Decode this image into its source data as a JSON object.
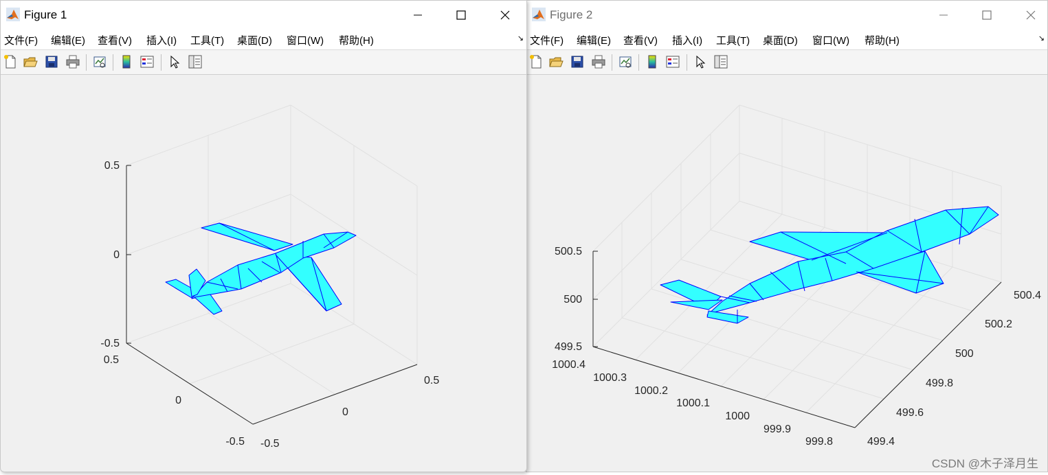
{
  "colors": {
    "surface": "#33ffff",
    "edge": "#0000ff",
    "axis": "#262626",
    "grid": "#e0e0e0"
  },
  "icons": [
    "new-figure-icon",
    "open-file-icon",
    "save-icon",
    "print-icon",
    "link-plot-icon",
    "colorbar-icon",
    "legend-icon",
    "edit-plot-arrow-icon",
    "property-inspector-icon"
  ],
  "menu": [
    {
      "id": "file",
      "label": "文件(F)"
    },
    {
      "id": "edit",
      "label": "编辑(E)"
    },
    {
      "id": "view",
      "label": "查看(V)"
    },
    {
      "id": "insert",
      "label": "插入(I)"
    },
    {
      "id": "tools",
      "label": "工具(T)"
    },
    {
      "id": "desktop",
      "label": "桌面(D)"
    },
    {
      "id": "window",
      "label": "窗口(W)"
    },
    {
      "id": "help",
      "label": "帮助(H)"
    }
  ],
  "windows": [
    {
      "title": "Figure 1",
      "ticks": {
        "z": [
          "0.5",
          "0",
          "-0.5"
        ],
        "x": [
          "0.5",
          "0",
          "-0.5"
        ],
        "y": [
          "-0.5",
          "0",
          "0.5"
        ]
      }
    },
    {
      "title": "Figure 2",
      "ticks": {
        "z": [
          "500.5",
          "500",
          "499.5"
        ],
        "x": [
          "1000.4",
          "1000.3",
          "1000.2",
          "1000.1",
          "1000",
          "999.9",
          "999.8"
        ],
        "y": [
          "499.4",
          "499.6",
          "499.8",
          "500",
          "500.2",
          "500.4"
        ]
      }
    }
  ],
  "watermark": "CSDN @木子泽月生"
}
